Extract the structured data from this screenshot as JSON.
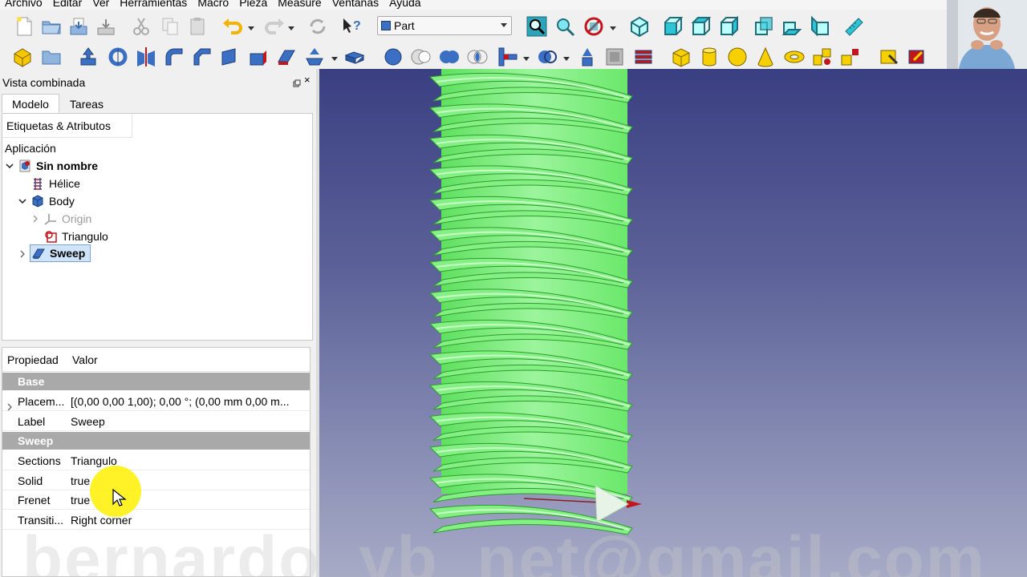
{
  "menu": [
    "Archivo",
    "Editar",
    "Ver",
    "Herramientas",
    "Macro",
    "Pieza",
    "Measure",
    "Ventanas",
    "Ayuda"
  ],
  "workbench": {
    "selected": "Part"
  },
  "toolbar1_icons": [
    "new-file-icon",
    "open-file-icon",
    "save-icon",
    "save-as-icon",
    "cut-icon",
    "copy-icon",
    "paste-icon",
    "undo-icon",
    "redo-icon",
    "refresh-icon",
    "whats-this-icon",
    "fit-all-icon",
    "fit-selection-icon",
    "draw-style-icon",
    "isometric-view-icon",
    "front-view-icon",
    "top-view-icon",
    "right-view-icon",
    "rear-view-icon",
    "bottom-view-icon",
    "left-view-icon",
    "measure-icon"
  ],
  "toolbar2_icons": [
    "part-design-icon",
    "folder-icon",
    "extrude-icon",
    "revolve-icon",
    "mirror-icon",
    "fillet-icon",
    "chamfer-icon",
    "make-face-icon",
    "ruled-surface-icon",
    "loft-icon",
    "sweep-icon",
    "section-icon",
    "cross-sections-icon",
    "offset-icon",
    "thickness-icon",
    "projection-icon",
    "boolean-icon",
    "cut-icon",
    "fuse-icon",
    "common-icon",
    "join-icon",
    "split-icon",
    "compound-icon",
    "explode-compound-icon",
    "check-geometry-icon",
    "defeaturing-icon",
    "box-icon",
    "cylinder-icon",
    "sphere-icon",
    "cone-icon",
    "torus-icon",
    "tube-icon",
    "primitives-icon",
    "shape-builder-icon",
    "attachment-icon",
    "color-icon"
  ],
  "combo": {
    "title": "Vista combinada",
    "close": "×",
    "tabs": [
      "Modelo",
      "Tareas"
    ],
    "active_tab": "Modelo"
  },
  "tree": {
    "header": "Etiquetas & Atributos",
    "root_label": "Aplicación",
    "document": "Sin nombre",
    "items": [
      {
        "label": "Hélice",
        "icon": "helix-icon"
      },
      {
        "label": "Body",
        "icon": "body-icon"
      },
      {
        "label": "Origin",
        "icon": "origin-icon"
      },
      {
        "label": "Triangulo",
        "icon": "sketch-icon"
      },
      {
        "label": "Sweep",
        "icon": "sweep-icon"
      }
    ]
  },
  "properties": {
    "col_property": "Propiedad",
    "col_value": "Valor",
    "groups": [
      {
        "name": "Base",
        "rows": [
          {
            "name": "Placem...",
            "value": "[(0,00 0,00 1,00); 0,00 °; (0,00 mm  0,00 m..."
          },
          {
            "name": "Label",
            "value": "Sweep"
          }
        ]
      },
      {
        "name": "Sweep",
        "rows": [
          {
            "name": "Sections",
            "value": "Triangulo"
          },
          {
            "name": "Solid",
            "value": "true"
          },
          {
            "name": "Frenet",
            "value": "true"
          },
          {
            "name": "Transiti...",
            "value": "Right corner"
          }
        ]
      }
    ]
  },
  "watermark": "bernardo_yb_net@gmail.com",
  "colors": {
    "thread_green": "#7cf07c",
    "view_top": "#3a3f82",
    "view_bottom": "#a8abc6",
    "selection": "#cfe3f9",
    "group_header": "#a9a9a9"
  }
}
